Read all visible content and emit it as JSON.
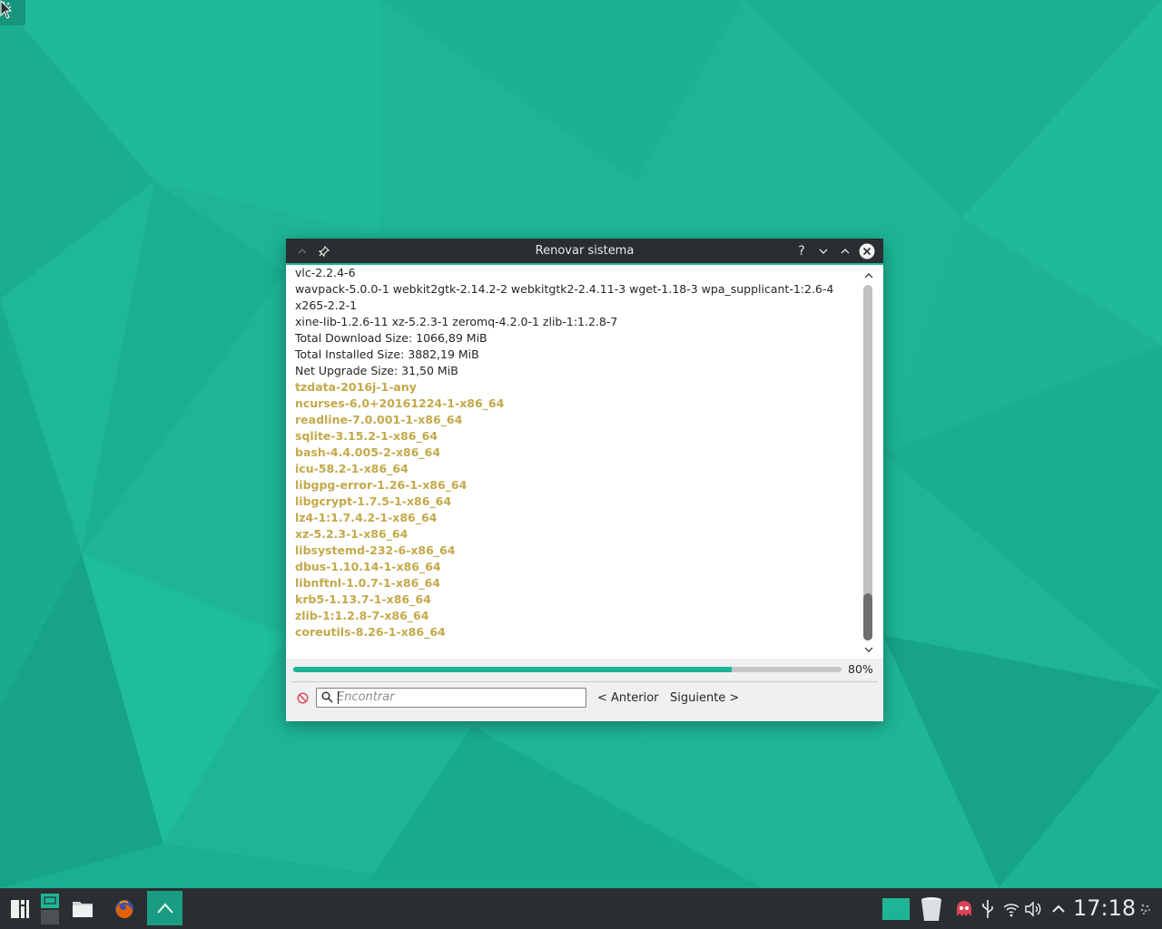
{
  "window": {
    "title": "Renovar sistema",
    "log_lines": [
      {
        "text": "vlc-2.2.4-6",
        "style": "normal"
      },
      {
        "text": "wavpack-5.0.0-1 webkit2gtk-2.14.2-2 webkitgtk2-2.4.11-3 wget-1.18-3 wpa_supplicant-1:2.6-4",
        "style": "normal"
      },
      {
        "text": "x265-2.2-1",
        "style": "normal"
      },
      {
        "text": "xine-lib-1.2.6-11 xz-5.2.3-1 zeromq-4.2.0-1 zlib-1:1.2.8-7",
        "style": "normal"
      },
      {
        "text": "Total Download Size: 1066,89 MiB",
        "style": "normal"
      },
      {
        "text": "Total Installed Size: 3882,19 MiB",
        "style": "normal"
      },
      {
        "text": "Net Upgrade Size: 31,50 MiB",
        "style": "normal"
      },
      {
        "text": "tzdata-2016j-1-any",
        "style": "pkg"
      },
      {
        "text": "ncurses-6.0+20161224-1-x86_64",
        "style": "pkg"
      },
      {
        "text": "readline-7.0.001-1-x86_64",
        "style": "pkg"
      },
      {
        "text": "sqlite-3.15.2-1-x86_64",
        "style": "pkg"
      },
      {
        "text": "bash-4.4.005-2-x86_64",
        "style": "pkg"
      },
      {
        "text": "icu-58.2-1-x86_64",
        "style": "pkg"
      },
      {
        "text": "libgpg-error-1.26-1-x86_64",
        "style": "pkg"
      },
      {
        "text": "libgcrypt-1.7.5-1-x86_64",
        "style": "pkg"
      },
      {
        "text": "lz4-1:1.7.4.2-1-x86_64",
        "style": "pkg"
      },
      {
        "text": "xz-5.2.3-1-x86_64",
        "style": "pkg"
      },
      {
        "text": "libsystemd-232-6-x86_64",
        "style": "pkg"
      },
      {
        "text": "dbus-1.10.14-1-x86_64",
        "style": "pkg"
      },
      {
        "text": "libnftnl-1.0.7-1-x86_64",
        "style": "pkg"
      },
      {
        "text": "krb5-1.13.7-1-x86_64",
        "style": "pkg"
      },
      {
        "text": "zlib-1:1.2.8-7-x86_64",
        "style": "pkg"
      },
      {
        "text": "coreutils-8.26-1-x86_64",
        "style": "pkg"
      }
    ],
    "progress": {
      "fraction": 0.8,
      "label": "80%"
    },
    "find": {
      "placeholder": "Encontrar",
      "previous_label": "< Anterior",
      "next_label": "Siguiente >"
    }
  },
  "taskbar": {
    "clock": "17:18"
  },
  "colors": {
    "desktop": "#1db596",
    "accent": "#1db596",
    "package_text": "#c3a94a",
    "titlebar": "#2b2e31",
    "taskbar": "#2b2e31"
  },
  "icons": {
    "titlebar": [
      "shade-icon",
      "pin-icon",
      "help-icon",
      "minimize-icon",
      "maximize-icon",
      "close-icon"
    ],
    "taskbar": [
      "app-launcher-icon",
      "pager-icon",
      "file-manager-icon",
      "firefox-icon",
      "software-update-icon",
      "show-desktop-icon",
      "trash-icon",
      "pamac-icon",
      "usb-icon",
      "network-icon",
      "volume-icon",
      "tray-expand-icon",
      "plasma-toolbox-icon"
    ]
  }
}
